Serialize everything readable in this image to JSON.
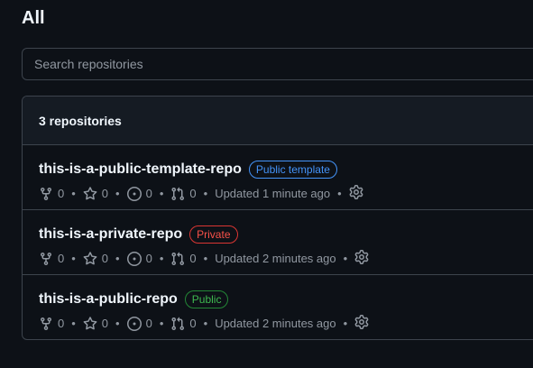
{
  "page": {
    "title": "All"
  },
  "search": {
    "placeholder": "Search repositories",
    "value": ""
  },
  "repo_list": {
    "count_label": "3 repositories",
    "repos": [
      {
        "name": "this-is-a-public-template-repo",
        "visibility": "Public template",
        "forks": "0",
        "stars": "0",
        "issues": "0",
        "pull_requests": "0",
        "updated": "Updated 1 minute ago"
      },
      {
        "name": "this-is-a-private-repo",
        "visibility": "Private",
        "forks": "0",
        "stars": "0",
        "issues": "0",
        "pull_requests": "0",
        "updated": "Updated 2 minutes ago"
      },
      {
        "name": "this-is-a-public-repo",
        "visibility": "Public",
        "forks": "0",
        "stars": "0",
        "issues": "0",
        "pull_requests": "0",
        "updated": "Updated 2 minutes ago"
      }
    ]
  },
  "colors": {
    "background": "#0d1117",
    "border": "#3d444d",
    "template_badge": "#4493f8",
    "private_badge": "#f85149",
    "public_badge": "#3fb950",
    "muted_text": "#9198a1"
  },
  "icons": [
    "fork-icon",
    "star-icon",
    "issue-icon",
    "pull-request-icon",
    "gear-icon"
  ]
}
